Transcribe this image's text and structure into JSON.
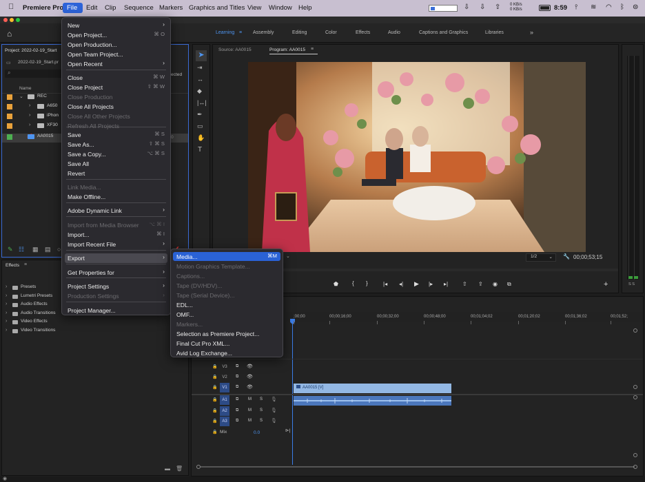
{
  "menubar": {
    "apple": "",
    "app": "Premiere Pro",
    "items": [
      "File",
      "Edit",
      "Clip",
      "Sequence",
      "Markers",
      "Graphics and Titles",
      "View",
      "Window",
      "Help"
    ],
    "net_top": "0 KB/s",
    "net_bottom": "0 KB/s",
    "time": "8:59"
  },
  "workspaces": [
    "Learning",
    "Assembly",
    "Editing",
    "Color",
    "Effects",
    "Audio",
    "Captions and Graphics",
    "Libraries"
  ],
  "project": {
    "title": "Project: 2022-02-19_Start",
    "file": "2022-02-19_Start.pr",
    "col_name": "Name",
    "col_right": "ected",
    "rows": [
      {
        "name": "REC",
        "color": "#e9a23b"
      },
      {
        "name": "A650",
        "color": "#e9a23b"
      },
      {
        "name": "iPhon",
        "color": "#e9a23b"
      },
      {
        "name": "XF30",
        "color": "#e9a23b"
      },
      {
        "name": "AA0015",
        "color": "#4caf50"
      }
    ],
    "row_value": "0"
  },
  "effects": {
    "title": "Effects",
    "items": [
      "Presets",
      "Lumetri Presets",
      "Audio Effects",
      "Audio Transitions",
      "Video Effects",
      "Video Transitions"
    ]
  },
  "monitor": {
    "source_tab": "Source: AA0015",
    "program_tab": "Program: AA0015",
    "scale": "1/2",
    "timecode": "00;00;53;15"
  },
  "timeline": {
    "ruler": [
      ";00;00",
      "00;00;16;00",
      "00;00;32;00",
      "00;00;48;00",
      "00;01;04;02",
      "00;01;20;02",
      "00;01;36;02",
      "00;01;52;"
    ],
    "video_tracks": [
      "V3",
      "V2",
      "V1"
    ],
    "audio_tracks": [
      "A1",
      "A2",
      "A3"
    ],
    "mix_label": "Mix",
    "mix_value": "0.0",
    "clip_label": "AA0015 [V]"
  },
  "meters": {
    "solo": "S S"
  },
  "file_menu": {
    "items": [
      {
        "label": "New",
        "arrow": true
      },
      {
        "label": "Open Project...",
        "shortcut": "⌘ O"
      },
      {
        "label": "Open Production..."
      },
      {
        "label": "Open Team Project..."
      },
      {
        "label": "Open Recent",
        "arrow": true
      },
      {
        "label": "Close",
        "shortcut": "⌘ W"
      },
      {
        "label": "Close Project",
        "shortcut": "⇧ ⌘ W"
      },
      {
        "label": "Close Production",
        "disabled": true
      },
      {
        "label": "Close All Projects"
      },
      {
        "label": "Close All Other Projects",
        "disabled": true
      },
      {
        "label": "Refresh All Projects",
        "disabled": true
      },
      {
        "label": "Save",
        "shortcut": "⌘ S"
      },
      {
        "label": "Save As...",
        "shortcut": "⇧ ⌘ S"
      },
      {
        "label": "Save a Copy...",
        "shortcut": "⌥ ⌘ S"
      },
      {
        "label": "Save All"
      },
      {
        "label": "Revert"
      },
      {
        "label": "Link Media...",
        "disabled": true
      },
      {
        "label": "Make Offline..."
      },
      {
        "label": "Adobe Dynamic Link",
        "arrow": true
      },
      {
        "label": "Import from Media Browser",
        "shortcut": "⌥ ⌘ I",
        "disabled": true
      },
      {
        "label": "Import...",
        "shortcut": "⌘ I"
      },
      {
        "label": "Import Recent File",
        "arrow": true
      },
      {
        "label": "Export",
        "arrow": true
      },
      {
        "label": "Get Properties for",
        "arrow": true
      },
      {
        "label": "Project Settings",
        "arrow": true
      },
      {
        "label": "Production Settings",
        "arrow": true,
        "disabled": true
      },
      {
        "label": "Project Manager..."
      }
    ]
  },
  "export_menu": {
    "items": [
      {
        "label": "Media...",
        "shortcut": "⌘M"
      },
      {
        "label": "Motion Graphics Template...",
        "disabled": true
      },
      {
        "label": "Captions...",
        "disabled": true
      },
      {
        "label": "Tape (DV/HDV)...",
        "disabled": true
      },
      {
        "label": "Tape (Serial Device)...",
        "disabled": true
      },
      {
        "label": "EDL..."
      },
      {
        "label": "OMF..."
      },
      {
        "label": "Markers...",
        "disabled": true
      },
      {
        "label": "Selection as Premiere Project..."
      },
      {
        "label": "Final Cut Pro XML..."
      },
      {
        "label": "Avid Log Exchange..."
      }
    ]
  }
}
